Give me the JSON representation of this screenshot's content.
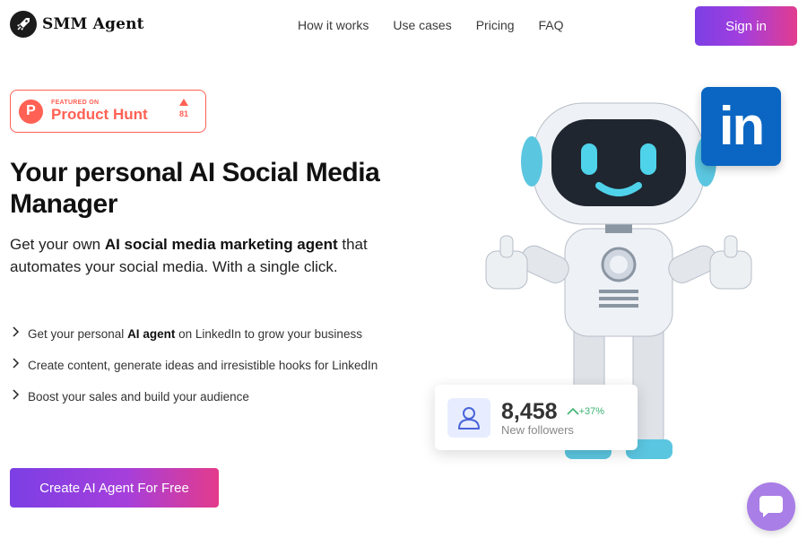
{
  "header": {
    "brand": "SMM Agent",
    "nav": [
      "How it works",
      "Use cases",
      "Pricing",
      "FAQ"
    ],
    "sign_in": "Sign in"
  },
  "product_hunt": {
    "featured_label": "FEATURED ON",
    "name": "Product Hunt",
    "votes": "81",
    "logo_letter": "P"
  },
  "hero": {
    "title": "Your personal AI Social Media Manager",
    "subtitle_pre": "Get your own ",
    "subtitle_bold": "AI social media marketing agent",
    "subtitle_post": " that automates your social media. With a single click."
  },
  "features": [
    {
      "pre": "Get your personal ",
      "bold": "AI agent",
      "post": " on LinkedIn to grow your business"
    },
    {
      "pre": "Create content, generate ideas and irresistible hooks for LinkedIn",
      "bold": "",
      "post": ""
    },
    {
      "pre": "Boost your sales and build your audience",
      "bold": "",
      "post": ""
    }
  ],
  "cta": "Create AI Agent For Free",
  "linkedin_badge": "in",
  "stat_card": {
    "value": "8,458",
    "growth": "+37%",
    "label": "New followers"
  },
  "colors": {
    "gradient_start": "#7b3fe4",
    "gradient_end": "#e33b8c",
    "product_hunt": "#ff6154",
    "linkedin": "#0a66c2",
    "growth": "#3cb371",
    "chat": "#a97ee6"
  },
  "icons": {
    "logo": "rocket-icon",
    "feature_bullet": "chevron-right-icon",
    "growth": "chevron-up-icon",
    "user": "user-icon",
    "chat": "chat-bubble-icon"
  }
}
